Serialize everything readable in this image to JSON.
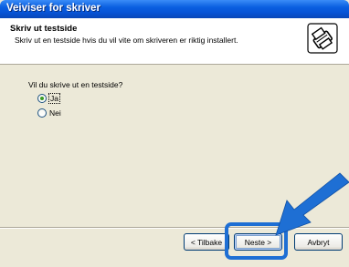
{
  "window": {
    "title": "Veiviser for skriver"
  },
  "header": {
    "title": "Skriv ut testside",
    "subtitle": "Skriv ut en testside hvis du vil vite om skriveren er riktig installert.",
    "icon": "printer-icon"
  },
  "content": {
    "question": "Vil du skrive ut en testside?",
    "options": [
      {
        "label": "Ja",
        "selected": true
      },
      {
        "label": "Nei",
        "selected": false
      }
    ]
  },
  "buttons": {
    "back": "< Tilbake",
    "next": "Neste >",
    "cancel": "Avbryt"
  },
  "colors": {
    "titlebar": "#0a5fe0",
    "highlight": "#1e6fd4",
    "window_bg": "#ece9d8"
  }
}
